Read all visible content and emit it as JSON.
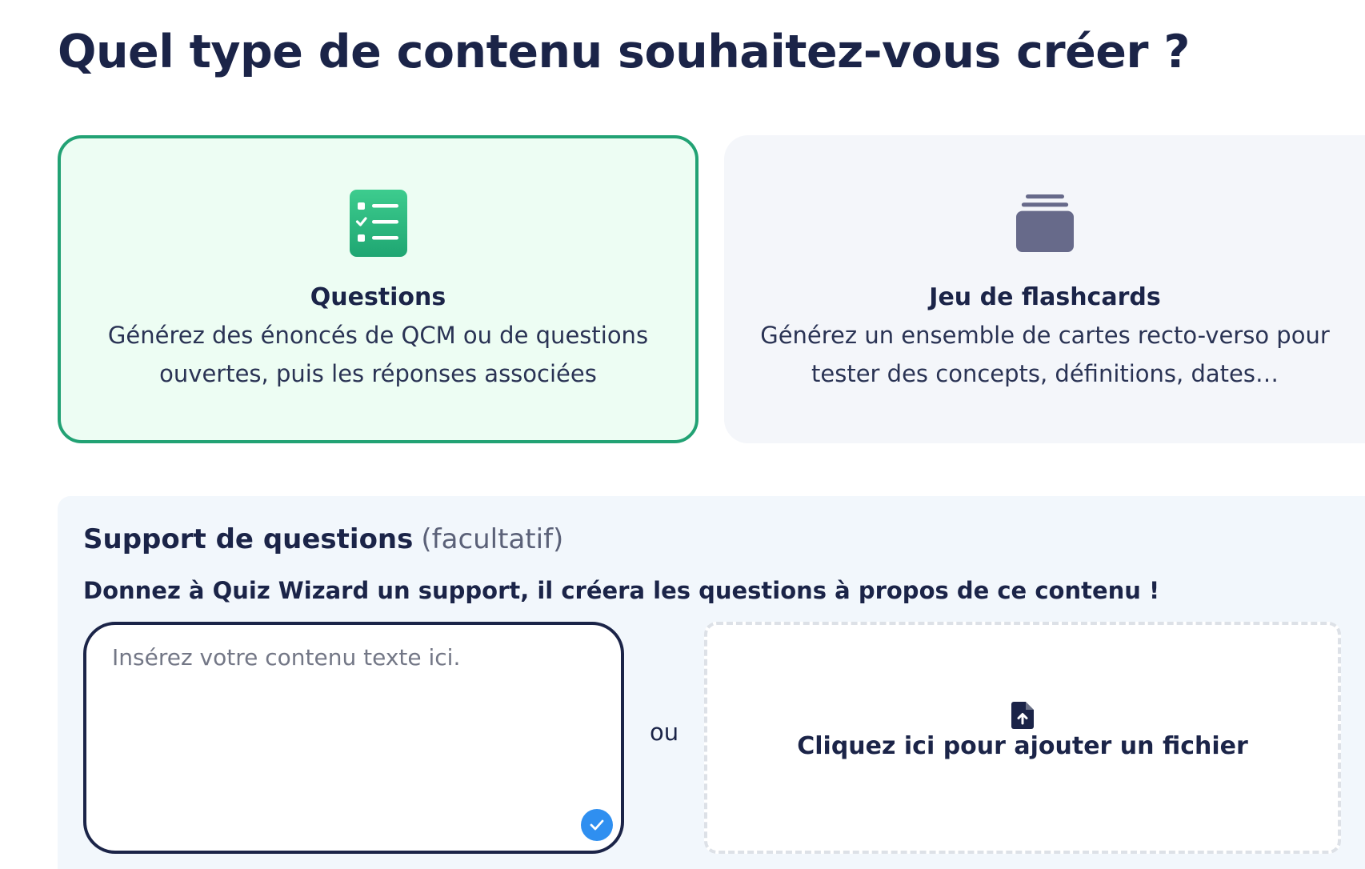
{
  "page": {
    "title": "Quel type de contenu souhaitez-vous créer ?"
  },
  "content_types": [
    {
      "title": "Questions",
      "description": "Générez des énoncés de QCM ou de questions ouvertes, puis les réponses associées",
      "icon": "checklist-icon",
      "selected": true
    },
    {
      "title": "Jeu de flashcards",
      "description": "Générez un ensemble de cartes recto-verso pour tester des concepts, définitions, dates…",
      "icon": "card-stack-icon",
      "selected": false
    }
  ],
  "support": {
    "heading": "Support de questions",
    "optional_label": "(facultatif)",
    "subtitle": "Donnez à Quiz Wizard un support, il créera les questions à propos de ce contenu !",
    "text_input": {
      "value": "",
      "placeholder": "Insérez votre contenu texte ici."
    },
    "or_label": "ou",
    "file_upload_label": "Cliquez ici pour ajouter un fichier"
  },
  "colors": {
    "navy": "#1b2448",
    "green_accent": "#22a274",
    "green_bg": "#edfdf3",
    "grey_card_bg": "#f4f6fa",
    "panel_bg": "#f2f7fc",
    "card_icon_grey": "#676a8a",
    "check_blue": "#2f8ff0"
  }
}
